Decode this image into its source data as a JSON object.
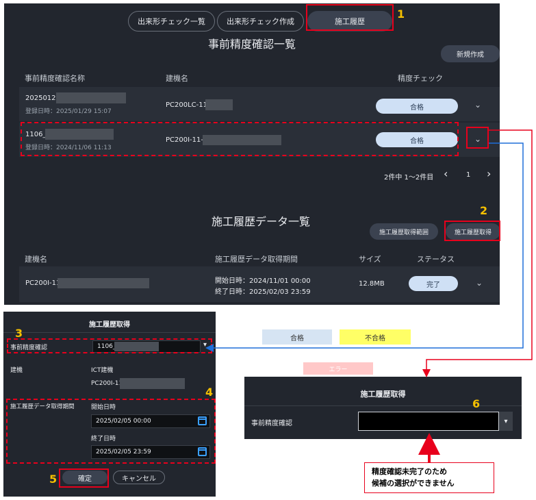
{
  "tabs": [
    {
      "label": "出来形チェック一覧"
    },
    {
      "label": "出来形チェック作成"
    },
    {
      "label": "施工履歴"
    }
  ],
  "precision": {
    "title": "事前精度確認一覧",
    "new_button": "新規作成",
    "headers": {
      "name": "事前精度確認名称",
      "machine": "建機名",
      "check": "精度チェック"
    },
    "rows": [
      {
        "name": "20250129",
        "date": "登録日時：2025/01/29 15:07",
        "machine": "PC200LC-11-",
        "check": "合格"
      },
      {
        "name": "1106_",
        "date": "登録日時：2024/11/06 11:13",
        "machine": "PC200I-11-(",
        "check": "合格"
      }
    ],
    "pagination": {
      "summary": "2件中 1～2件目",
      "prev": "‹",
      "page": "1",
      "next": "›"
    }
  },
  "history": {
    "title": "施工履歴データ一覧",
    "range_button": "施工履歴取得範囲",
    "fetch_button": "施工履歴取得",
    "headers": {
      "machine": "建機名",
      "period": "施工履歴データ取得期間",
      "size": "サイズ",
      "status": "ステータス"
    },
    "row": {
      "machine": "PC200I-11",
      "start": "開始日時：2024/11/01 00:00",
      "end": "終了日時：2025/02/03 23:59",
      "size": "12.8MB",
      "status": "完了"
    }
  },
  "dialog": {
    "title": "施工履歴取得",
    "precision_label": "事前精度確認",
    "precision_value": "1106_",
    "machine_label": "建機",
    "ict_label": "ICT建機",
    "ict_value": "PC200I-11",
    "period_label": "施工履歴データ取得期間",
    "start_label": "開始日時",
    "start_value": "2025/02/05 00:00",
    "end_label": "終了日時",
    "end_value": "2025/02/05 23:59",
    "confirm": "確定",
    "cancel": "キャンセル"
  },
  "legend": {
    "pass": "合格",
    "fail": "不合格",
    "error": "エラー"
  },
  "dialog2": {
    "title": "施工履歴取得",
    "precision_label": "事前精度確認"
  },
  "note": {
    "line1": "精度確認未完了のため",
    "line2": "候補の選択ができません"
  },
  "markers": [
    "1",
    "2",
    "3",
    "4",
    "5",
    "6"
  ],
  "colors": {
    "panel": "#22262e",
    "accent_red": "#e8001c",
    "accent_blue": "#1e6fd9",
    "marker": "#f5c000",
    "pass": "#cfe0f5",
    "fail": "#ffff66",
    "error": "#ffc8c8"
  }
}
